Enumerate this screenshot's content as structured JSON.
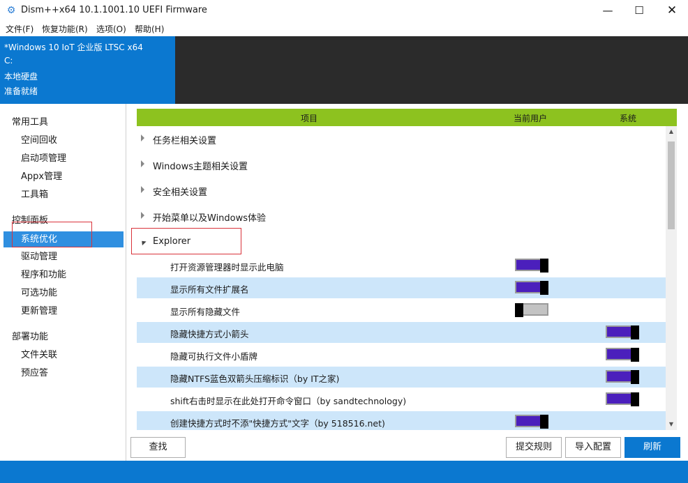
{
  "window": {
    "title": "Dism++x64 10.1.1001.10 UEFI Firmware",
    "icon": "gear-icon",
    "min_glyph": "—",
    "max_glyph": "☐",
    "close_glyph": "✕"
  },
  "menu": [
    "文件(F)",
    "恢复功能(R)",
    "选项(O)",
    "帮助(H)"
  ],
  "image_info": {
    "name": "*Windows 10 IoT 企业版 LTSC x64",
    "drive": "C:",
    "disk": "本地硬盘",
    "status": "准备就绪"
  },
  "sidebar": {
    "groups": [
      {
        "label": "常用工具",
        "items": [
          "空间回收",
          "启动项管理",
          "Appx管理",
          "工具箱"
        ]
      },
      {
        "label": "控制面板",
        "items": [
          "系统优化",
          "驱动管理",
          "程序和功能",
          "可选功能",
          "更新管理"
        ]
      },
      {
        "label": "部署功能",
        "items": [
          "文件关联",
          "预应答"
        ]
      }
    ],
    "active": "系统优化"
  },
  "table": {
    "headers": {
      "item": "项目",
      "user": "当前用户",
      "system": "系统"
    },
    "categories": [
      "任务栏相关设置",
      "Windows主题相关设置",
      "安全相关设置",
      "开始菜单以及Windows体验",
      "Explorer"
    ],
    "options": [
      {
        "label": "打开资源管理器时显示此电脑",
        "user": "on",
        "system": null
      },
      {
        "label": "显示所有文件扩展名",
        "user": "on",
        "system": null
      },
      {
        "label": "显示所有隐藏文件",
        "user": "off",
        "system": null
      },
      {
        "label": "隐藏快捷方式小箭头",
        "user": null,
        "system": "on"
      },
      {
        "label": "隐藏可执行文件小盾牌",
        "user": null,
        "system": "on"
      },
      {
        "label": "隐藏NTFS蓝色双箭头压缩标识（by IT之家)",
        "user": null,
        "system": "on"
      },
      {
        "label": "shift右击时显示在此处打开命令窗口（by sandtechnology)",
        "user": null,
        "system": "on"
      },
      {
        "label": "创建快捷方式时不添\"快捷方式\"文字（by 518516.net)",
        "user": "on",
        "system": null
      }
    ]
  },
  "buttons": {
    "find": "查找",
    "submit": "提交规则",
    "import": "导入配置",
    "refresh": "刷新"
  },
  "colors": {
    "accent": "#0b78d0",
    "header_green": "#8dc21f",
    "toggle_on": "#4b1fbc",
    "highlight_box": "#d9323a",
    "alt_row": "#cde6fa"
  }
}
